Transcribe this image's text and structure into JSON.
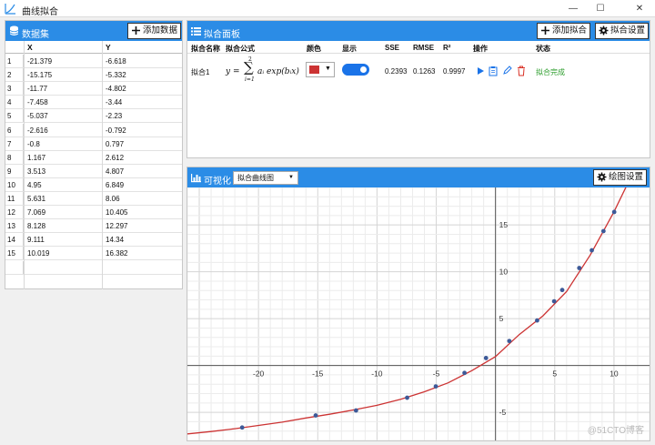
{
  "window": {
    "title": "曲线拟合",
    "controls": [
      "—",
      "☐",
      "✕"
    ]
  },
  "colors": {
    "accent": "#2b8ce6",
    "curve": "#cc3333",
    "points": "#3d5a98",
    "toggle": "#1a73e8",
    "status": "#2e9e2e"
  },
  "dataset": {
    "title": "数据集",
    "add_button": "添加数据",
    "columns": [
      "X",
      "Y"
    ],
    "rows": [
      {
        "i": "1",
        "x": "-21.379",
        "y": "-6.618"
      },
      {
        "i": "2",
        "x": "-15.175",
        "y": "-5.332"
      },
      {
        "i": "3",
        "x": "-11.77",
        "y": "-4.802"
      },
      {
        "i": "4",
        "x": "-7.458",
        "y": "-3.44"
      },
      {
        "i": "5",
        "x": "-5.037",
        "y": "-2.23"
      },
      {
        "i": "6",
        "x": "-2.616",
        "y": "-0.792"
      },
      {
        "i": "7",
        "x": "-0.8",
        "y": "0.797"
      },
      {
        "i": "8",
        "x": "1.167",
        "y": "2.612"
      },
      {
        "i": "9",
        "x": "3.513",
        "y": "4.807"
      },
      {
        "i": "10",
        "x": "4.95",
        "y": "6.849"
      },
      {
        "i": "11",
        "x": "5.631",
        "y": "8.06"
      },
      {
        "i": "12",
        "x": "7.069",
        "y": "10.405"
      },
      {
        "i": "13",
        "x": "8.128",
        "y": "12.297"
      },
      {
        "i": "14",
        "x": "9.111",
        "y": "14.34"
      },
      {
        "i": "15",
        "x": "10.019",
        "y": "16.382"
      }
    ]
  },
  "fit_panel": {
    "title": "拟合面板",
    "add_button": "添加拟合",
    "settings_button": "拟合设置",
    "headers": {
      "name": "拟合名称",
      "formula": "拟合公式",
      "color": "颜色",
      "show": "显示",
      "sse": "SSE",
      "rmse": "RMSE",
      "r2": "R²",
      "ops": "操作",
      "status": "状态"
    },
    "row": {
      "name": "拟合1",
      "formula_lhs": "y =",
      "formula_sum_top": "2",
      "formula_sum_bottom": "i=1",
      "formula_body": "aᵢ exp(bᵢx)",
      "swatch_color": "#cc3333",
      "visible": true,
      "sse": "0.2393",
      "rmse": "0.1263",
      "r2": "0.9997",
      "status": "拟合完成"
    }
  },
  "viz": {
    "title": "可视化",
    "plot_type": "拟合曲线图",
    "settings_button": "绘图设置",
    "watermark": "@51CTO博客"
  },
  "chart_data": {
    "type": "scatter",
    "title": "",
    "xlabel": "",
    "ylabel": "",
    "xlim": [
      -26,
      13
    ],
    "ylim": [
      -8,
      19
    ],
    "x_ticks": [
      -20,
      -15,
      -10,
      -5,
      5,
      10
    ],
    "y_ticks": [
      -5,
      5,
      10,
      15
    ],
    "grid": true,
    "series": [
      {
        "kind": "points",
        "x": [
          -21.379,
          -15.175,
          -11.77,
          -7.458,
          -5.037,
          -2.616,
          -0.8,
          1.167,
          3.513,
          4.95,
          5.631,
          7.069,
          8.128,
          9.111,
          10.019
        ],
        "y": [
          -6.618,
          -5.332,
          -4.802,
          -3.44,
          -2.23,
          -0.792,
          0.797,
          2.612,
          4.807,
          6.849,
          8.06,
          10.405,
          12.297,
          14.34,
          16.382
        ]
      },
      {
        "kind": "fit",
        "x": [
          -26,
          -24,
          -22,
          -20,
          -18,
          -16,
          -14,
          -12,
          -10,
          -8,
          -6,
          -4,
          -2,
          0,
          2,
          4,
          6,
          8,
          10,
          11,
          12
        ],
        "y": [
          -7.3,
          -7.05,
          -6.75,
          -6.4,
          -6.05,
          -5.6,
          -5.2,
          -4.75,
          -4.25,
          -3.6,
          -2.8,
          -1.85,
          -0.55,
          0.95,
          3.3,
          5.3,
          7.9,
          11.8,
          16.4,
          19.0,
          21.9
        ]
      }
    ]
  }
}
